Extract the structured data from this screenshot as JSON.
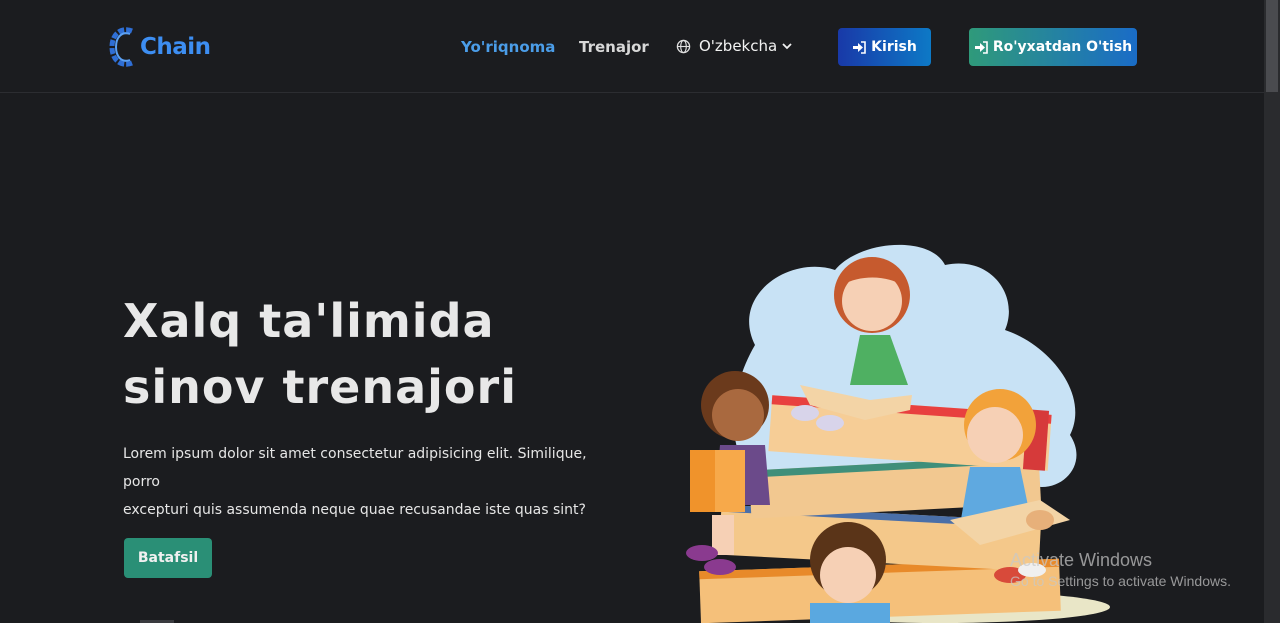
{
  "brand": {
    "name": "Chain",
    "icon": "chain-link-logo-icon",
    "color": "#3d8ef2"
  },
  "nav": {
    "links": [
      {
        "label": "Yo'riqnoma",
        "active": true
      },
      {
        "label": "Trenajor",
        "active": false
      }
    ],
    "language": {
      "label": "O'zbekcha",
      "icon": "globe-icon"
    },
    "login": {
      "label": "Kirish",
      "icon": "sign-in-icon"
    },
    "register": {
      "label": "Ro'yxatdan O'tish",
      "icon": "sign-in-icon"
    }
  },
  "hero": {
    "title_line1": "Xalq ta'limida",
    "title_line2": "sinov trenajori",
    "text_line1": "Lorem ipsum dolor sit amet consectetur adipisicing elit. Similique, porro",
    "text_line2": "excepturi quis assumenda neque quae recusandae iste quas sint?",
    "button_label": "Batafsil",
    "illustration": "children-reading-books-illustration"
  },
  "watermark": {
    "line1": "Activate Windows",
    "line2": "Go to Settings to activate Windows."
  },
  "colors": {
    "background": "#1b1c1f",
    "accent": "#4b9de8",
    "primary_button": "#2a8f76"
  }
}
